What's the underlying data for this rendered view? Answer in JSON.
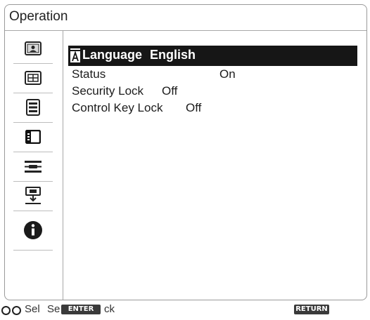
{
  "window": {
    "title": "Operation"
  },
  "sidebar": {
    "items": [
      {
        "icon": "picture-icon"
      },
      {
        "icon": "screen-icon"
      },
      {
        "icon": "setup-icon"
      },
      {
        "icon": "operation-icon",
        "active": true
      },
      {
        "icon": "connection-icon"
      },
      {
        "icon": "installation-icon"
      },
      {
        "icon": "information-icon"
      }
    ]
  },
  "menu": {
    "language": {
      "label": "Language",
      "value": "English"
    },
    "status": {
      "label": "Status",
      "value": "On"
    },
    "security_lock": {
      "label": "Security Lock",
      "value": "Off"
    },
    "control_key_lock": {
      "label": "Control Key Lock",
      "value": "Off"
    }
  },
  "footer": {
    "sel": "Sel",
    "set_prefix": "Se",
    "enter_key": "ENTER",
    "back_suffix": "ck",
    "return_key": "RETURN"
  }
}
